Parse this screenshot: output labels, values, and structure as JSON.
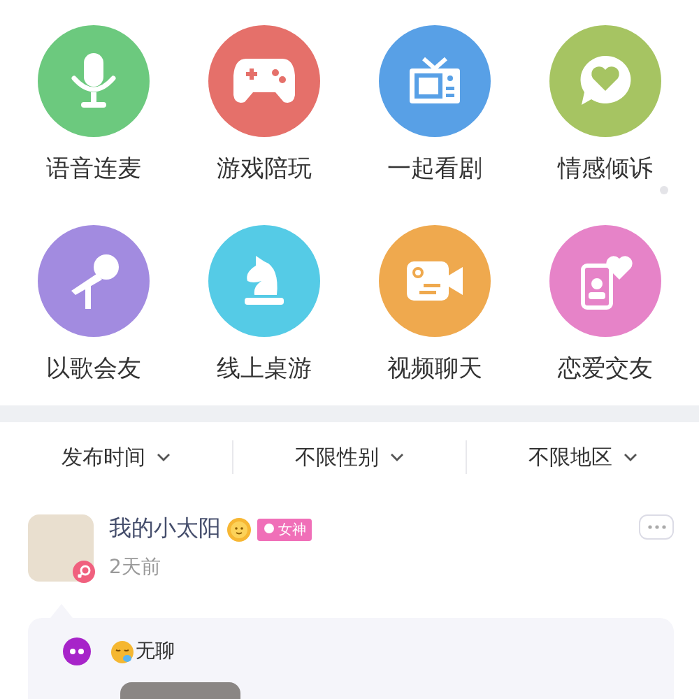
{
  "categories": [
    {
      "label": "语音连麦",
      "kind": "mic",
      "color": "#6cc97e",
      "dot": false
    },
    {
      "label": "游戏陪玩",
      "kind": "gamepad",
      "color": "#e5706a",
      "dot": false
    },
    {
      "label": "一起看剧",
      "kind": "tv",
      "color": "#58a0e6",
      "dot": false
    },
    {
      "label": "情感倾诉",
      "kind": "chat",
      "color": "#a6c462",
      "dot": true
    },
    {
      "label": "以歌会友",
      "kind": "karaoke",
      "color": "#a28be0",
      "dot": false
    },
    {
      "label": "线上桌游",
      "kind": "chess",
      "color": "#55cbe6",
      "dot": false
    },
    {
      "label": "视频聊天",
      "kind": "camera",
      "color": "#efa94e",
      "dot": false
    },
    {
      "label": "恋爱交友",
      "kind": "phoneheart",
      "color": "#e683c8",
      "dot": false
    }
  ],
  "filters": [
    {
      "label": "发布时间"
    },
    {
      "label": "不限性别"
    },
    {
      "label": "不限地区"
    }
  ],
  "post": {
    "name": "我的小太阳",
    "badge": "女神",
    "time": "2天前",
    "mood": "无聊"
  }
}
